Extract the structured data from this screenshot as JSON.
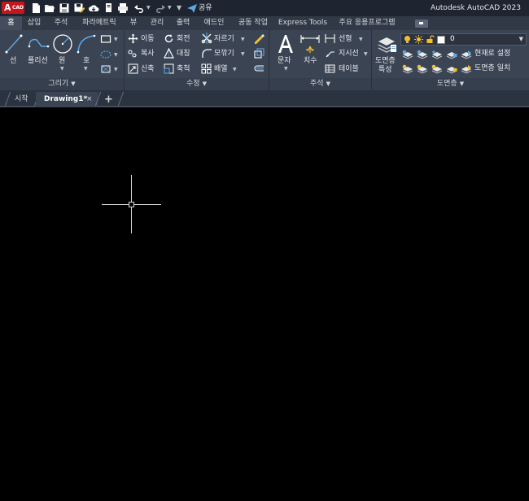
{
  "titlebar": {
    "logo_main": "A",
    "logo_sub": "CAD",
    "share_label": "공유",
    "app_title": "Autodesk AutoCAD 2023"
  },
  "ribbon_tabs": [
    "홈",
    "삽입",
    "주석",
    "파라메트릭",
    "뷰",
    "관리",
    "출력",
    "애드인",
    "공동 작업",
    "Express Tools",
    "주요 응용프로그램"
  ],
  "active_tab": "홈",
  "panels": {
    "draw": {
      "title": "그리기",
      "line": "선",
      "polyline": "폴리선",
      "circle": "원",
      "arc": "호"
    },
    "modify": {
      "title": "수정",
      "move": "이동",
      "rotate": "회전",
      "trim": "자르기",
      "copy": "복사",
      "mirror": "대칭",
      "fillet": "모깎기",
      "stretch": "신축",
      "scale": "축척",
      "array": "배열"
    },
    "annotation": {
      "title": "주석",
      "text": "문자",
      "dimension": "치수",
      "linear": "선형",
      "leader": "지시선",
      "table": "테이블"
    },
    "layers": {
      "title": "도면층",
      "properties_line1": "도면층",
      "properties_line2": "특성",
      "current_layer": "0",
      "make_current": "현재로 설정",
      "match_layer": "도면층 일치"
    }
  },
  "file_tabs": {
    "start": "시작",
    "drawing": "Drawing1*",
    "close": "×",
    "new": "+"
  },
  "colors": {
    "accent_red": "#c4161c",
    "titlebar_bg": "#1e2530",
    "ribbon_bg": "#3b4453",
    "canvas_bg": "#000000",
    "icon_blue": "#5ea7e8",
    "icon_yellow": "#f3c02d"
  }
}
